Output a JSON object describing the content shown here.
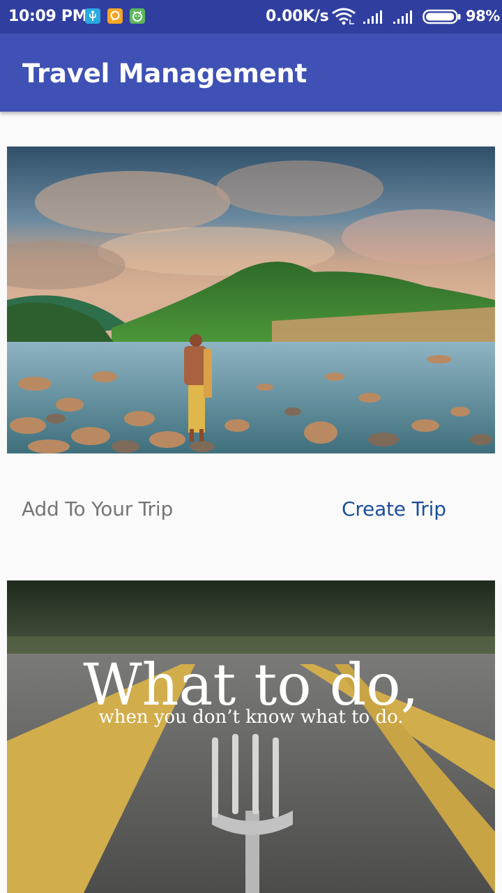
{
  "status_bar": {
    "time": "10:09 PM",
    "network_speed": "0.00K/s",
    "battery_percent": "98%",
    "battery_level": 0.98,
    "icons": [
      "usb-icon",
      "chat-notification-icon",
      "android-notification-icon",
      "wifi-icon",
      "cell-signal-icon",
      "cell-signal-icon",
      "battery-icon"
    ]
  },
  "app_bar": {
    "title": "Travel Management",
    "color": "#3f51b5",
    "status_color": "#303f9f"
  },
  "main": {
    "add_to_trip_label": "Add To Your Trip",
    "create_trip_label": "Create Trip",
    "create_trip_color": "#1c4f9c",
    "image_1": {
      "description_icon": "landscape-river-photo"
    },
    "image_2": {
      "headline": "What to do,",
      "subline": "when you don’t know what to do."
    }
  }
}
